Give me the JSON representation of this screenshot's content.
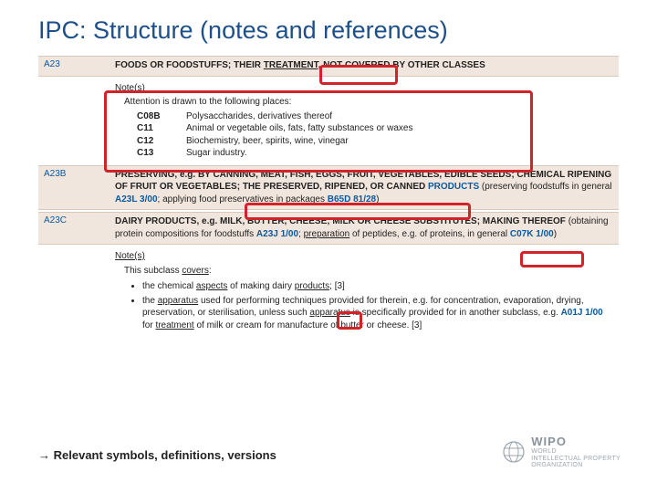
{
  "title": "IPC: Structure (notes and references)",
  "sections": [
    {
      "code": "A23",
      "heading_pre": "FOODS OR FOODSTUFFS; THEIR ",
      "heading_hl": "TREATMENT",
      "heading_post": ", NOT COVERED BY OTHER CLASSES",
      "notes_label": "Note(s)",
      "note_intro": "Attention is drawn to the following places:",
      "refs": [
        {
          "code": "C08B",
          "desc": "Polysaccharides, derivatives thereof"
        },
        {
          "code": "C11",
          "desc": "Animal or vegetable oils, fats, fatty substances or waxes"
        },
        {
          "code": "C12",
          "desc": "Biochemistry, beer, spirits, wine, vinegar"
        },
        {
          "code": "C13",
          "desc": "Sugar industry."
        }
      ]
    },
    {
      "code": "A23B",
      "heading_pre": "PRESERVING, e.g. BY CANNING, MEAT, FISH, EGGS, FRUIT, VEGETABLES, EDIBLE SEEDS; CHEMICAL RIPENING OF FRUIT OR VEGETABLES; THE PRESERVED, RIPENED, OR CANNED ",
      "heading_prod": "PRODUCTS",
      "paren_pre": " (",
      "paren_hl": "preserving foodstuffs in general ",
      "paren_link": "A23L 3/00",
      "paren_post": "; applying food preservatives in packages ",
      "paren_link2": "B65D 81/28",
      "paren_close": ")"
    },
    {
      "code": "A23C",
      "heading_pre": "DAIRY PRODUCTS, e.g. MILK, BUTTER, CHEESE; MILK OR CHEESE SUBSTITUTES; MAKING THEREOF",
      "paren_pre": " (obtaining protein compositions for foodstuffs ",
      "paren_link": "A23J 1/00",
      "paren_mid": "; ",
      "paren_hl2": "preparation",
      "paren_post2": " of peptides, e.g. of proteins, in general ",
      "paren_link2": "C07K 1/00",
      "paren_close": ")",
      "notes_label": "Note(s)",
      "sub_intro": "This subclass covers:",
      "bullets": {
        "b1_pre": "the chemical ",
        "b1_u1": "aspects",
        "b1_mid": " of making dairy ",
        "b1_u2": "products",
        "b1_post": ";   ",
        "b1_ver": "[3]",
        "b2_pre": "the ",
        "b2_u1": "apparatus",
        "b2_mid": " used for performing techniques provided for therein, e.g. for concentration, evaporation, drying, preservation, or sterilisation, unless such ",
        "b2_u2": "apparatus",
        "b2_post": " is specifically provided for in another subclass, e.g. ",
        "b2_link": "A01J 1/00",
        "b2_tail": " for ",
        "b2_u3": "treatment",
        "b2_end": " of milk or cream for manufacture of butter or cheese.  ",
        "b2_ver": "[3]"
      }
    }
  ],
  "footer": "Relevant symbols, definitions, versions",
  "arrow": "→",
  "wipo": {
    "name": "WIPO",
    "l1": "WORLD",
    "l2": "INTELLECTUAL PROPERTY",
    "l3": "ORGANIZATION"
  }
}
